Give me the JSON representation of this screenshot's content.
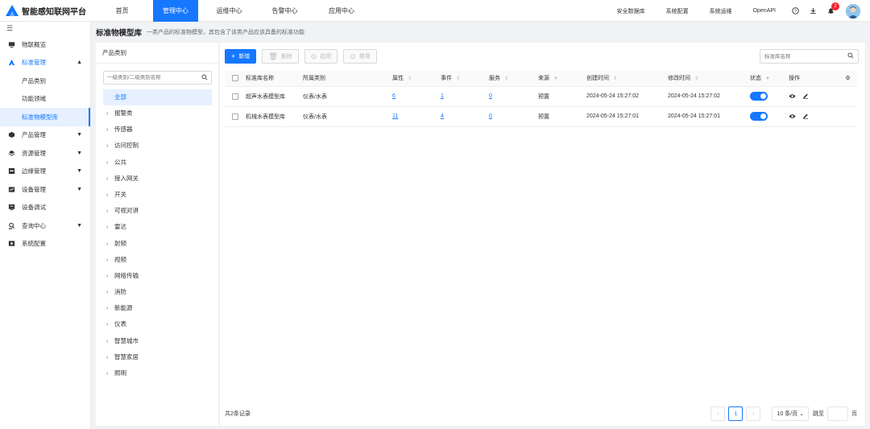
{
  "app": {
    "title": "智能感知联网平台"
  },
  "nav": [
    {
      "label": "首页",
      "active": false
    },
    {
      "label": "管理中心",
      "active": true
    },
    {
      "label": "运维中心",
      "active": false
    },
    {
      "label": "告警中心",
      "active": false
    },
    {
      "label": "应用中心",
      "active": false
    }
  ],
  "topright": {
    "links": [
      "安全数据库",
      "系统配置",
      "系统运维",
      "OpenAPI"
    ],
    "notification_count": "2",
    "icons": [
      "help-icon",
      "download-icon",
      "bell-icon"
    ]
  },
  "sidebar": {
    "items": [
      {
        "label": "物联概览",
        "icon": "monitor-icon"
      },
      {
        "label": "标准管理",
        "icon": "standard-icon",
        "open": true,
        "children": [
          {
            "label": "产品类别"
          },
          {
            "label": "功能领域"
          },
          {
            "label": "标准物模型库",
            "active": true
          }
        ]
      },
      {
        "label": "产品管理",
        "icon": "product-icon",
        "arrow": true
      },
      {
        "label": "资源管理",
        "icon": "layers-icon",
        "arrow": true
      },
      {
        "label": "边缘管理",
        "icon": "edge-icon",
        "arrow": true
      },
      {
        "label": "设备管理",
        "icon": "device-icon",
        "arrow": true
      },
      {
        "label": "设备调试",
        "icon": "debug-icon"
      },
      {
        "label": "查询中心",
        "icon": "query-icon",
        "arrow": true
      },
      {
        "label": "系统配置",
        "icon": "settings-icon"
      }
    ]
  },
  "page": {
    "title": "标准物模型库",
    "description": "一类产品的标准物模型，其包含了该类产品应该具备的标准功能"
  },
  "category": {
    "title": "产品类别",
    "search_placeholder": "一级类别/二级类别名称",
    "all_label": "全部",
    "items": [
      "报警类",
      "传感器",
      "访问控制",
      "公共",
      "接入网关",
      "开关",
      "可视对讲",
      "雷达",
      "射频",
      "视频",
      "网络传输",
      "消防",
      "新能源",
      "仪表",
      "智慧城市",
      "智慧家居",
      "照明"
    ]
  },
  "toolbar": {
    "add_label": "新增",
    "delete_label": "删除",
    "enable_label": "启用",
    "disable_label": "禁用",
    "search_placeholder": "标准库名称"
  },
  "table": {
    "headers": {
      "name": "标准库名称",
      "category": "所属类别",
      "props": "属性",
      "events": "事件",
      "services": "服务",
      "source": "来源",
      "created": "创建时间",
      "modified": "修改时间",
      "status": "状态",
      "ops": "操作"
    },
    "rows": [
      {
        "name": "超声水表模型库",
        "category": "仪表/水表",
        "props": "6",
        "events": "1",
        "services": "0",
        "source": "预置",
        "created": "2024-05-24 15:27:02",
        "modified": "2024-05-24 15:27:02",
        "enabled": true
      },
      {
        "name": "机械水表模型库",
        "category": "仪表/水表",
        "props": "11",
        "events": "4",
        "services": "0",
        "source": "预置",
        "created": "2024-05-24 15:27:01",
        "modified": "2024-05-24 15:27:01",
        "enabled": true
      }
    ]
  },
  "footer": {
    "total_text": "共2条记录",
    "current_page": "1",
    "page_size": "10 条/页",
    "jump_label": "跳至",
    "page_unit": "页"
  },
  "colors": {
    "primary": "#1677ff",
    "badge": "#f5222d"
  }
}
